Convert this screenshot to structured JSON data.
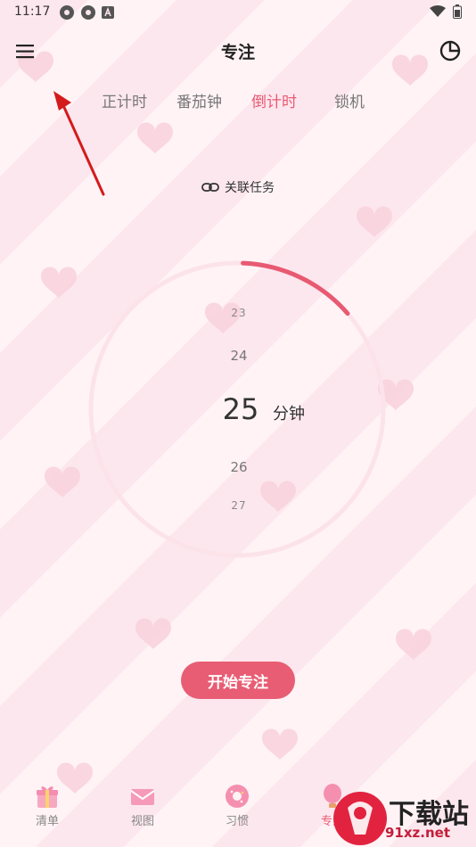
{
  "status_bar": {
    "time": "11:17"
  },
  "header": {
    "title": "专注"
  },
  "tabs": [
    {
      "label": "正计时"
    },
    {
      "label": "番茄钟"
    },
    {
      "label": "倒计时"
    },
    {
      "label": "锁机"
    }
  ],
  "link_task": {
    "label": "关联任务"
  },
  "timer": {
    "options": [
      "23",
      "24",
      "25",
      "26",
      "27"
    ],
    "selected": "25",
    "unit": "分钟",
    "progress": 0.13
  },
  "start_button": {
    "label": "开始专注"
  },
  "bottom_nav": [
    {
      "label": "清单"
    },
    {
      "label": "视图"
    },
    {
      "label": "习惯"
    },
    {
      "label": "专注"
    }
  ],
  "watermark": {
    "line1": "下载站",
    "line2": "91xz.net"
  },
  "colors": {
    "accent": "#e85a72",
    "button": "#e85d74",
    "ring": "#fce3ea"
  }
}
